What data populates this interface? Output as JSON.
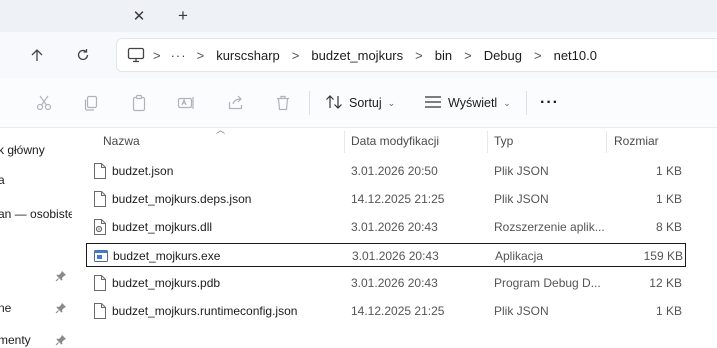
{
  "tabbar": {
    "close_icon": "close-icon",
    "new_tab_icon": "plus-icon"
  },
  "nav": {
    "up_icon": "arrow-up-icon",
    "refresh_icon": "refresh-icon",
    "computer_icon": "computer-icon",
    "overflow": "···",
    "breadcrumbs": [
      "kurscsharp",
      "budzet_mojkurs",
      "bin",
      "Debug",
      "net10.0"
    ],
    "separator": ">"
  },
  "toolbar": {
    "sort_label": "Sortuj",
    "view_label": "Wyświetl",
    "more_label": "···"
  },
  "sidebar": {
    "items": [
      {
        "label": "k główny",
        "pinned": false
      },
      {
        "label": "a",
        "pinned": false
      },
      {
        "label": "an — osobiste",
        "pinned": false
      },
      {
        "label": "",
        "pinned": true
      },
      {
        "label": "ne",
        "pinned": true
      },
      {
        "label": "menty",
        "pinned": true
      }
    ]
  },
  "columns": {
    "name": "Nazwa",
    "date": "Data modyfikacji",
    "type": "Typ",
    "size": "Rozmiar"
  },
  "files": [
    {
      "name": "budzet.json",
      "date": "3.01.2026 20:50",
      "type": "Plik JSON",
      "size": "1 KB",
      "icon": "json-file-icon"
    },
    {
      "name": "budzet_mojkurs.deps.json",
      "date": "14.12.2025 21:25",
      "type": "Plik JSON",
      "size": "1 KB",
      "icon": "json-file-icon"
    },
    {
      "name": "budzet_mojkurs.dll",
      "date": "3.01.2026 20:43",
      "type": "Rozszerzenie aplik...",
      "size": "8 KB",
      "icon": "dll-file-icon"
    },
    {
      "name": "budzet_mojkurs.exe",
      "date": "3.01.2026 20:43",
      "type": "Aplikacja",
      "size": "159 KB",
      "icon": "exe-file-icon",
      "selected": true
    },
    {
      "name": "budzet_mojkurs.pdb",
      "date": "3.01.2026 20:43",
      "type": "Program Debug D...",
      "size": "12 KB",
      "icon": "pdb-file-icon"
    },
    {
      "name": "budzet_mojkurs.runtimeconfig.json",
      "date": "14.12.2025 21:25",
      "type": "Plik JSON",
      "size": "1 KB",
      "icon": "json-file-icon"
    }
  ]
}
